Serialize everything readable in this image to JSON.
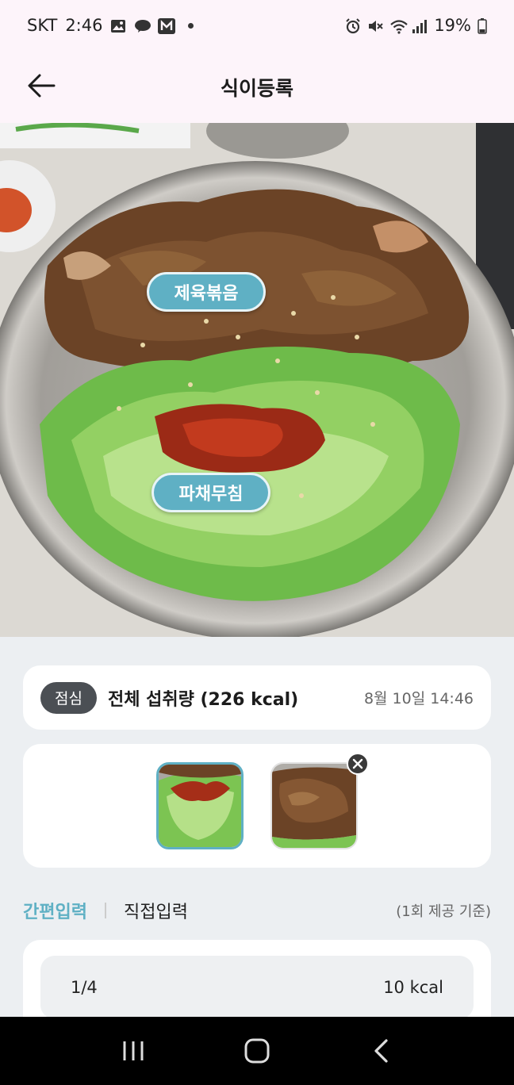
{
  "status": {
    "carrier": "SKT",
    "time": "2:46",
    "battery": "19%",
    "icons_left": [
      "gallery-icon",
      "kakaotalk-icon",
      "mstock-icon"
    ],
    "icons_right": [
      "alarm-icon",
      "mute-icon",
      "wifi-icon",
      "signal-icon",
      "battery-icon"
    ]
  },
  "appbar": {
    "title": "식이등록"
  },
  "photo": {
    "tags": [
      {
        "label": "제육볶음"
      },
      {
        "label": "파채무침"
      }
    ]
  },
  "summary": {
    "meal": "점심",
    "title": "전체 섭취량 (226 kcal)",
    "date": "8월 10일  14:46"
  },
  "tabs": {
    "quick": "간편입력",
    "manual": "직접입력",
    "note": "(1회 제공 기준)"
  },
  "portion": {
    "amount": "1/4",
    "kcal": "10 kcal"
  },
  "colors": {
    "accent": "#5fb0c4",
    "badge": "#4b4f54",
    "appbar_bg": "#fdf4fa",
    "page_bg": "#eceff2"
  }
}
